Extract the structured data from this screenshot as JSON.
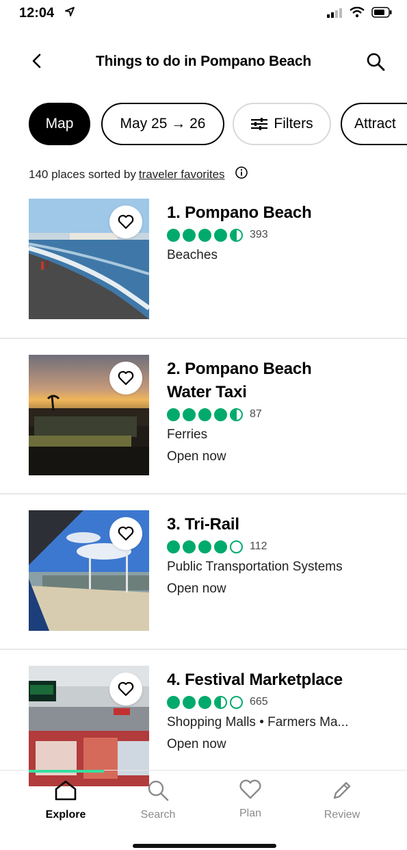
{
  "status_bar": {
    "time": "12:04"
  },
  "header": {
    "title": "Things to do in Pompano Beach"
  },
  "chips": {
    "map": "Map",
    "date": "May 25 → 26",
    "filters": "Filters",
    "attractions": "Attract"
  },
  "summary": {
    "prefix": "140 places sorted by",
    "link": "traveler favorites"
  },
  "colors": {
    "accent_green": "#00aa6c",
    "nav_progress": "#34e0a1"
  },
  "items": [
    {
      "title": "1. Pompano Beach",
      "rating": 4.5,
      "reviews": "393",
      "category": "Beaches",
      "status": ""
    },
    {
      "title": "2. Pompano Beach Water Taxi",
      "rating": 4.5,
      "reviews": "87",
      "category": "Ferries",
      "status": "Open now"
    },
    {
      "title": "3. Tri-Rail",
      "rating": 4.0,
      "reviews": "112",
      "category": "Public Transportation Systems",
      "status": "Open now"
    },
    {
      "title": "4. Festival Marketplace",
      "rating": 3.5,
      "reviews": "665",
      "category": "Shopping Malls • Farmers Ma...",
      "status": "Open now"
    }
  ],
  "nav": {
    "explore": "Explore",
    "search": "Search",
    "plan": "Plan",
    "review": "Review"
  }
}
